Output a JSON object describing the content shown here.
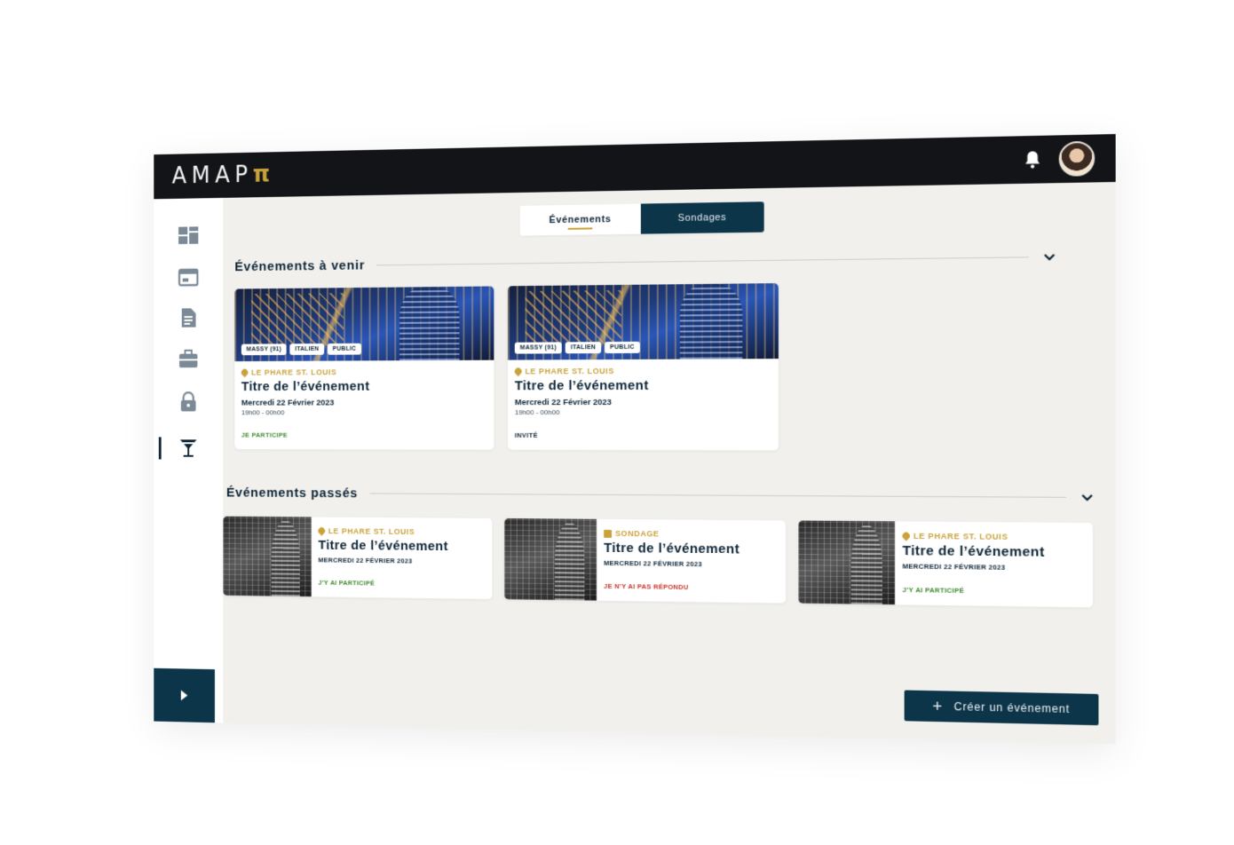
{
  "app": {
    "logo_main": "AMAP",
    "logo_accent": "π"
  },
  "header": {
    "bell_icon": "bell-icon",
    "avatar": "user-avatar"
  },
  "sidebar": {
    "items": [
      {
        "name": "dashboard",
        "icon": "dashboard-icon"
      },
      {
        "name": "calendar",
        "icon": "calendar-icon"
      },
      {
        "name": "documents",
        "icon": "document-icon"
      },
      {
        "name": "jobs",
        "icon": "briefcase-icon"
      },
      {
        "name": "security",
        "icon": "lock-icon"
      },
      {
        "name": "events",
        "icon": "cocktail-icon",
        "active": true
      }
    ],
    "expand_icon": "chevron-right-icon"
  },
  "tabs": [
    {
      "label": "Événements",
      "active": true
    },
    {
      "label": "Sondages",
      "active": false
    }
  ],
  "upcoming": {
    "title": "Événements à venir",
    "cards": [
      {
        "chips": [
          "MASSY (91)",
          "ITALIEN",
          "PUBLIC"
        ],
        "place": "LE PHARE ST. LOUIS",
        "title": "Titre de l’événement",
        "date": "Mercredi 22 Février 2023",
        "time": "19h00 - 00h00",
        "status": "JE PARTICIPE",
        "status_color": "#3f8a2f"
      },
      {
        "chips": [
          "MASSY (91)",
          "ITALIEN",
          "PUBLIC"
        ],
        "place": "LE PHARE ST. LOUIS",
        "title": "Titre de l’événement",
        "date": "Mercredi 22 Février 2023",
        "time": "19h00 - 00h00",
        "status": "INVITÉ",
        "status_color": "#0c2436"
      }
    ]
  },
  "past": {
    "title": "Événements passés",
    "cards": [
      {
        "place": "LE PHARE ST. LOUIS",
        "title": "Titre de l’événement",
        "date": "MERCREDI 22 FÉVRIER 2023",
        "status": "J’Y AI PARTICIPÉ",
        "status_color": "#3f8a2f"
      },
      {
        "place": "SONDAGE",
        "title": "Titre de l’événement",
        "date": "MERCREDI 22 FÉVRIER 2023",
        "status": "JE N’Y AI PAS RÉPONDU",
        "status_color": "#c8332b"
      },
      {
        "place": "LE PHARE ST. LOUIS",
        "title": "Titre de l’événement",
        "date": "MERCREDI 22 FÉVRIER 2023",
        "status": "J’Y AI PARTICIPÉ",
        "status_color": "#3f8a2f"
      }
    ]
  },
  "actions": {
    "create_label": "Créer un événement",
    "create_icon": "plus-icon"
  },
  "colors": {
    "navy": "#0c3549",
    "gold": "#c9a23a",
    "background": "#f1f0ec"
  }
}
